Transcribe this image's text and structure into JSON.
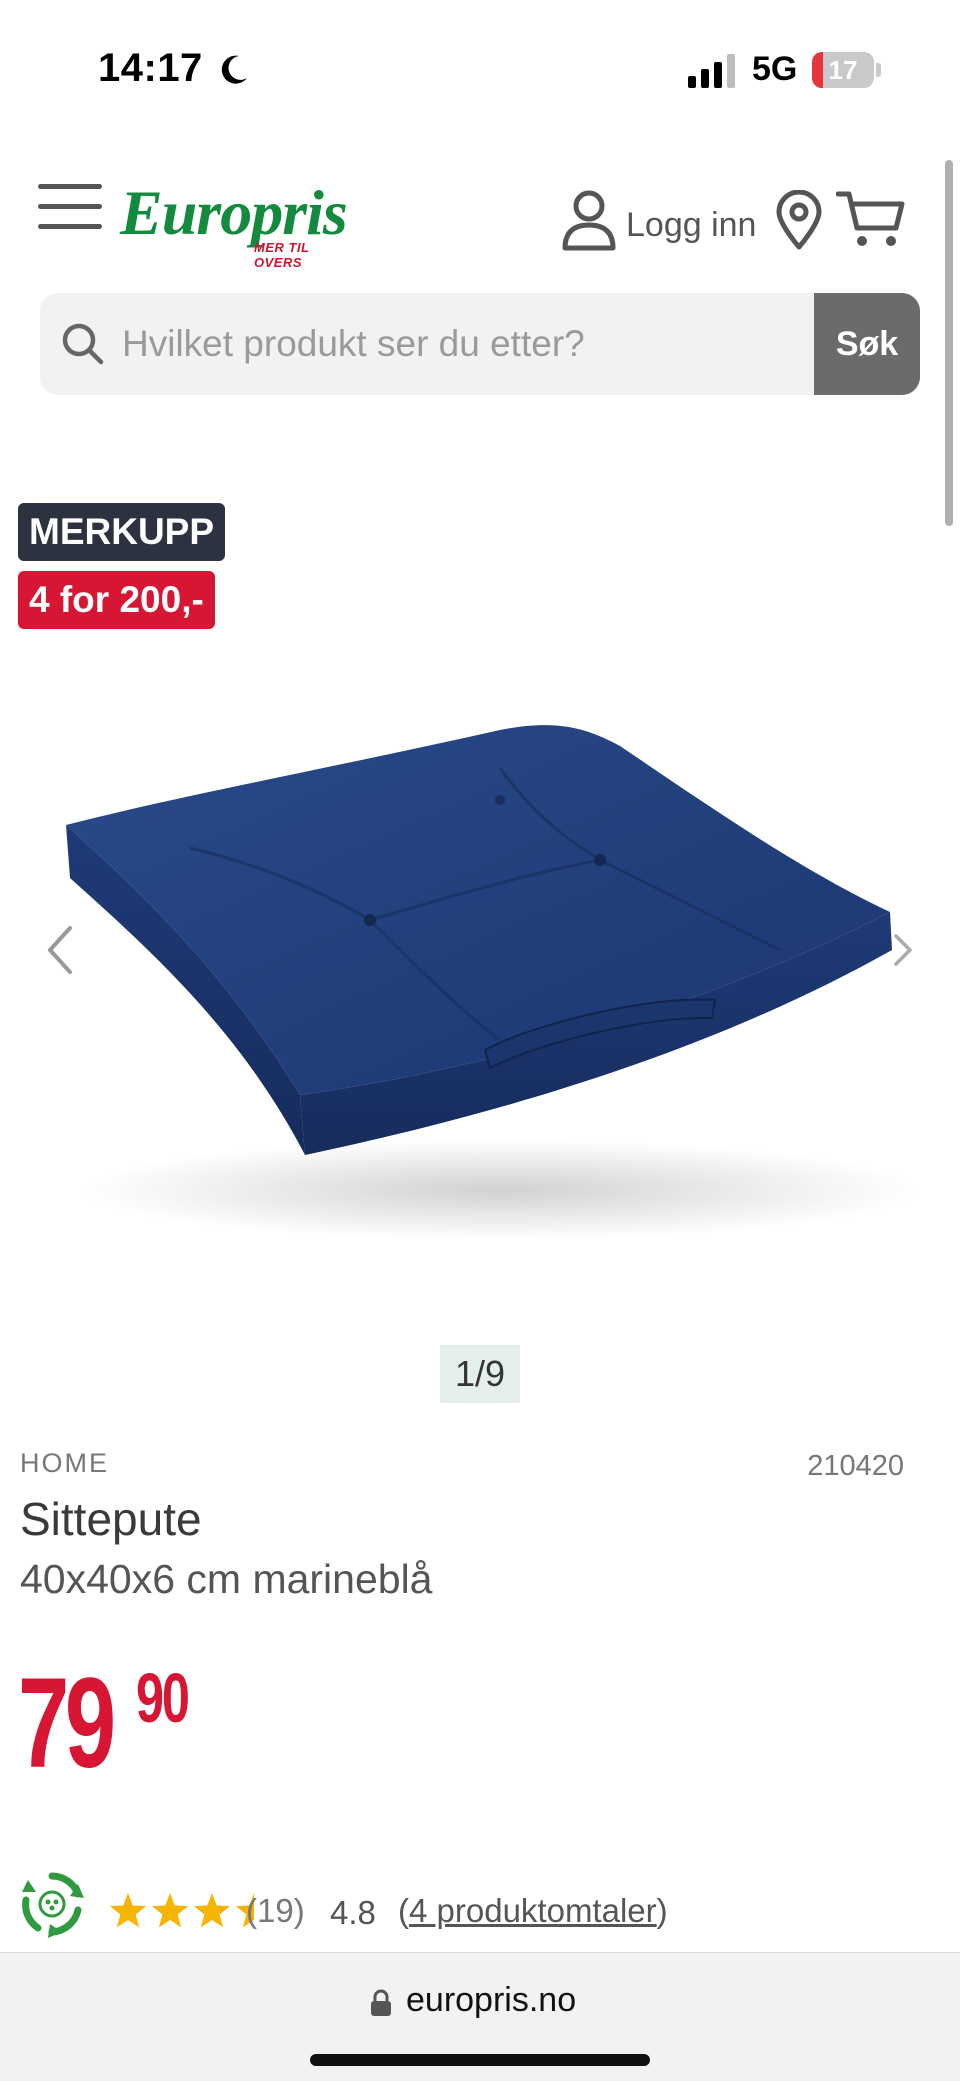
{
  "status_bar": {
    "time": "14:17",
    "network": "5G",
    "battery": "17",
    "battery_level": 0.17,
    "battery_color": "#e8343b"
  },
  "header": {
    "logo_text": "Europris",
    "logo_tagline": "MER TIL OVERS",
    "login_label": "Logg inn",
    "icons": [
      "menu-icon",
      "user-icon",
      "location-pin-icon",
      "cart-icon"
    ],
    "brand_color": "#138a3e"
  },
  "search": {
    "placeholder": "Hvilket produkt ser du etter?",
    "value": "",
    "button_label": "Søk"
  },
  "badges": {
    "deal": "MERKUPP",
    "offer": "4 for 200,-",
    "deal_color": "#2d3240",
    "offer_color": "#d71634"
  },
  "gallery": {
    "counter": "1/9",
    "icons": [
      "chevron-left-icon",
      "chevron-right-icon"
    ]
  },
  "product": {
    "brand": "HOME",
    "sku": "210420",
    "name": "Sittepute",
    "variant": "40x40x6 cm marineblå",
    "price_main": "79",
    "price_cents": "90",
    "price_color": "#d71634"
  },
  "rating": {
    "stars": 3.5,
    "stars_max": 5,
    "review_count": "(19)",
    "value": "4.8",
    "reviews_link_open": "(",
    "reviews_link": "4 produktomtaler",
    "reviews_link_close": ")"
  },
  "browser": {
    "url": "europris.no"
  }
}
